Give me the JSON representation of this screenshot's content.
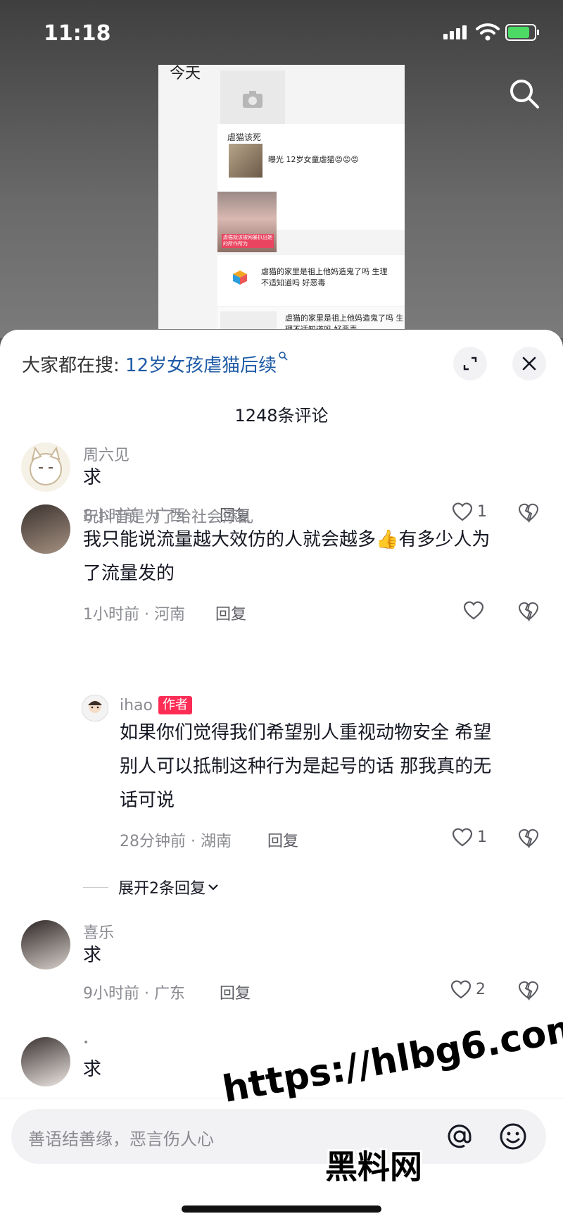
{
  "status": {
    "time": "11:18"
  },
  "video_preview": {
    "today": "今天",
    "card1_title": "虐猫该死",
    "card1_text": "曝光 12岁女童虐猫😡😡😡",
    "girl_caption": "虐猫就该被网暴扒出她的所作所为",
    "card2_text": "虐猫的家里是祖上他妈造鬼了吗 生理不适知道吗 好恶毒",
    "card3_text": "虐猫的家里是祖上他妈造鬼了吗 生理不适知道吗 好恶毒"
  },
  "hot_search": {
    "prefix": "大家都在搜:",
    "keyword": "12岁女孩虐猫后续"
  },
  "comment_count": "1248条评论",
  "comments": [
    {
      "user": "周六见",
      "text": "求",
      "meta": "8小时前 · 广西",
      "reply": "回复",
      "likes": "1"
    },
    {
      "user": "玩抖音是为了给社会添乱",
      "text_line1": "我只能说流量越大效仿的人就会越多👍有多少人为",
      "text_line2": "了流量发的",
      "meta": "1小时前 · 河南",
      "reply": "回复",
      "likes": ""
    },
    {
      "user": "ihao",
      "badge": "作者",
      "text_line1": "如果你们觉得我们希望别人重视动物安全 希望",
      "text_line2": "别人可以抵制这种行为是起号的话 那我真的无",
      "text_line3": "话可说",
      "meta": "28分钟前 · 湖南",
      "reply": "回复",
      "likes": "1"
    },
    {
      "user": "喜乐",
      "text": "求",
      "meta": "9小时前 · 广东",
      "reply": "回复",
      "likes": "2"
    },
    {
      "user": "•",
      "text": "求"
    }
  ],
  "expand_replies": "展开2条回复",
  "input": {
    "placeholder": "善语结善缘，恶言伤人心"
  },
  "watermark": {
    "url": "https://hlbg6.com",
    "site": "黑料网"
  },
  "colors": {
    "keyword": "#1f5ba6",
    "author_badge": "#fe2c55",
    "battery": "#4cd964"
  }
}
